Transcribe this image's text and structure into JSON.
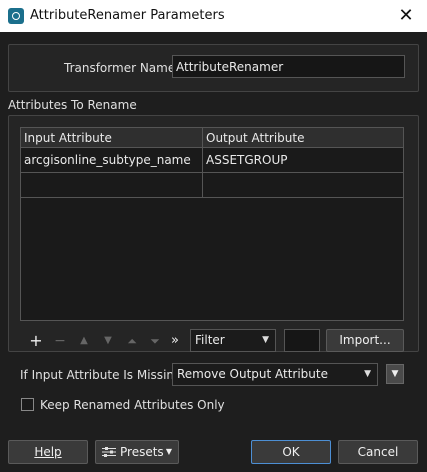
{
  "window": {
    "title": "AttributeRenamer Parameters",
    "close_glyph": "✕",
    "icon": "fme-transformer-icon"
  },
  "transformer": {
    "label": "Transformer Name:",
    "value": "AttributeRenamer"
  },
  "attributes_section": {
    "label": "Attributes To Rename",
    "columns": [
      "Input Attribute",
      "Output Attribute"
    ],
    "rows": [
      [
        "arcgisonline_subtype_name",
        "ASSETGROUP"
      ],
      [
        "",
        ""
      ]
    ]
  },
  "toolbar": {
    "add": "+",
    "remove": "−",
    "move_up": "▲",
    "move_down": "▼",
    "move_top": "⏶",
    "move_bottom": "⏷",
    "more": "»",
    "filter_value": "Filter",
    "import_label": "Import..."
  },
  "missing": {
    "label": "If Input Attribute Is Missing:",
    "value": "Remove Output Attribute"
  },
  "keep_renamed": {
    "label": "Keep Renamed Attributes Only",
    "checked": false
  },
  "buttons": {
    "help": "Help",
    "presets": "Presets",
    "ok": "OK",
    "cancel": "Cancel"
  },
  "colors": {
    "background": "#1e1e1e",
    "titlebar": "#ffffff",
    "ok_border": "#4d8fd4"
  }
}
